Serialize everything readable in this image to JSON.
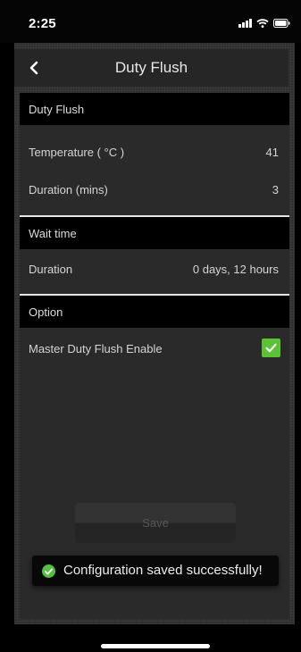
{
  "status_bar": {
    "time": "2:25"
  },
  "header": {
    "title": "Duty Flush",
    "back_icon": "chevron-left-icon"
  },
  "sections": {
    "duty_flush": {
      "title": "Duty Flush",
      "rows": [
        {
          "label": "Temperature ( °C )",
          "value": "41"
        },
        {
          "label": "Duration (mins)",
          "value": "3"
        }
      ]
    },
    "wait_time": {
      "title": "Wait time",
      "rows": [
        {
          "label": "Duration",
          "value": "0 days, 12 hours"
        }
      ]
    },
    "option": {
      "title": "Option",
      "rows": [
        {
          "label": "Master Duty Flush Enable",
          "checked": true
        }
      ]
    }
  },
  "actions": {
    "save_label": "Save"
  },
  "toast": {
    "message": "Configuration saved successfully!",
    "icon": "check-circle-icon"
  },
  "colors": {
    "accent_green": "#5bc236",
    "background": "#2a2a2a",
    "section_header": "#000000"
  }
}
